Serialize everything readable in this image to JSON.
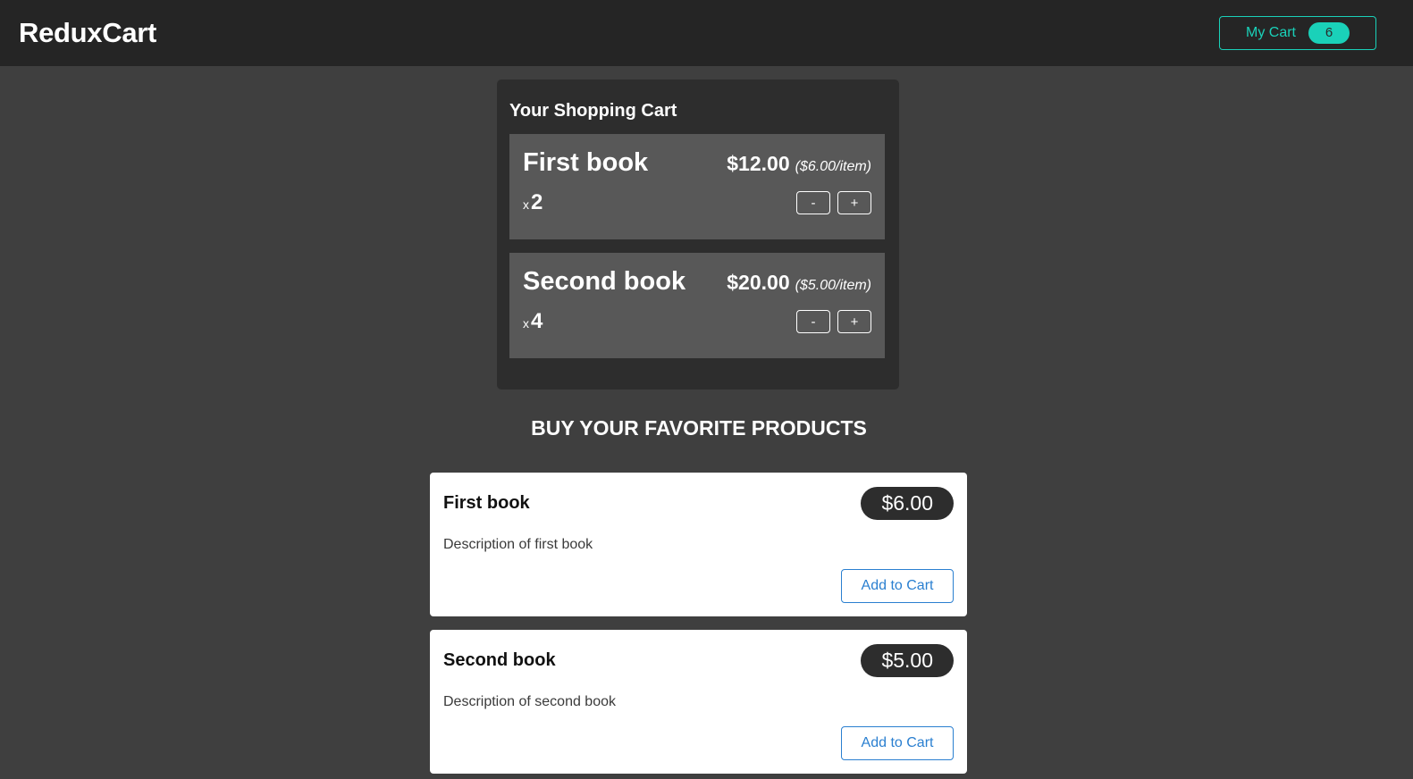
{
  "header": {
    "brand": "ReduxCart",
    "cart_label": "My Cart",
    "cart_count": "6"
  },
  "cart": {
    "title": "Your Shopping Cart",
    "items": [
      {
        "name": "First book",
        "total": "$12.00",
        "unit": "($6.00/item)",
        "qty_prefix": "x",
        "qty": "2",
        "minus": "-",
        "plus": "+"
      },
      {
        "name": "Second book",
        "total": "$20.00",
        "unit": "($5.00/item)",
        "qty_prefix": "x",
        "qty": "4",
        "minus": "-",
        "plus": "+"
      }
    ]
  },
  "products": {
    "title": "BUY YOUR FAVORITE PRODUCTS",
    "items": [
      {
        "name": "First book",
        "price": "$6.00",
        "description": "Description of first book",
        "add_label": "Add to Cart"
      },
      {
        "name": "Second book",
        "price": "$5.00",
        "description": "Description of second book",
        "add_label": "Add to Cart"
      }
    ]
  },
  "colors": {
    "accent": "#1ad1b9",
    "link": "#2a7fd0",
    "header_bg": "#252525",
    "page_bg": "#3f3f3f"
  }
}
